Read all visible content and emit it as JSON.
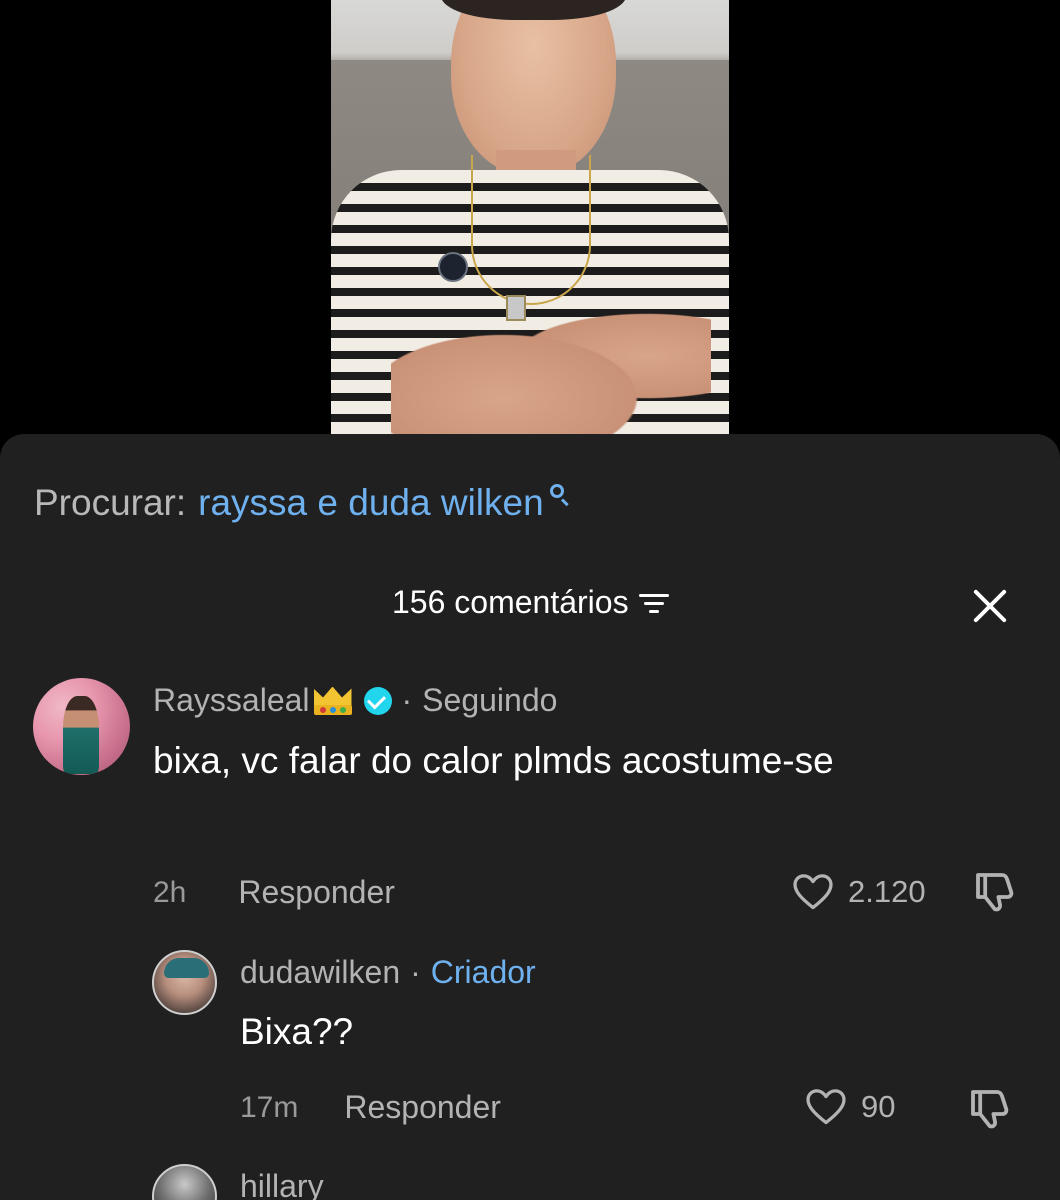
{
  "search": {
    "label": "Procurar:",
    "query": "rayssa e duda wilken"
  },
  "header": {
    "comment_count": "156 comentários"
  },
  "comments": [
    {
      "username": "Rayssaleal",
      "badges": [
        "crown-emoji",
        "verified-icon"
      ],
      "separator": "·",
      "tag": "Seguindo",
      "text": "bixa, vc falar do calor plmds acostume-se",
      "time": "2h",
      "reply_label": "Responder",
      "likes": "2.120"
    },
    {
      "username": "dudawilken",
      "separator": "·",
      "tag": "Criador",
      "text": "Bixa??",
      "time": "17m",
      "reply_label": "Responder",
      "likes": "90"
    },
    {
      "username": "hillary"
    }
  ],
  "colors": {
    "sheet_bg": "#202020",
    "accent_blue": "#6fb0ee",
    "muted_text": "#b3b3b3",
    "verified": "#20d5ec"
  }
}
